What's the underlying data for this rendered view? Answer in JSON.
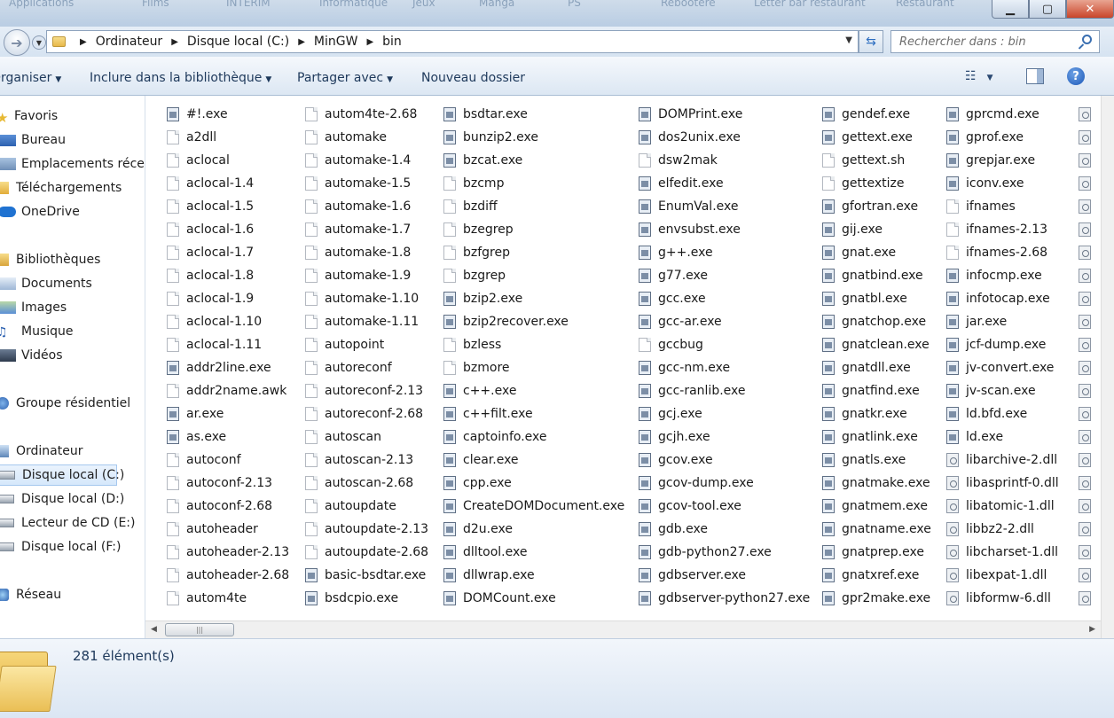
{
  "background_apps": [
    "Applications",
    "Films",
    "INTERIM",
    "Informatique",
    "Jeux",
    "Manga",
    "PS",
    "Rebootere",
    "Letter bar restaurant",
    "Restaurant"
  ],
  "window_controls": {
    "minimize": "▁",
    "maximize": "▢",
    "close": "✕"
  },
  "address": {
    "breadcrumbs": [
      "Ordinateur",
      "Disque local (C:)",
      "MinGW",
      "bin"
    ],
    "search_placeholder": "Rechercher dans : bin"
  },
  "toolbar": {
    "organize": "Organiser",
    "include_library": "Inclure dans la bibliothèque",
    "share_with": "Partager avec",
    "new_folder": "Nouveau dossier"
  },
  "sidebar": {
    "favorites": {
      "label": "Favoris",
      "items": [
        "Bureau",
        "Emplacements récents",
        "Téléchargements",
        "OneDrive"
      ]
    },
    "libraries": {
      "label": "Bibliothèques",
      "items": [
        "Documents",
        "Images",
        "Musique",
        "Vidéos"
      ]
    },
    "homegroup": "Groupe résidentiel",
    "computer": {
      "label": "Ordinateur",
      "items": [
        "Disque local (C:)",
        "Disque local (D:)",
        "Lecteur de CD (E:)",
        "Disque local (F:)"
      ],
      "selected": "Disque local (C:)"
    },
    "network": "Réseau"
  },
  "files": [
    [
      {
        "n": "#!.exe",
        "t": "exe"
      },
      {
        "n": "a2dll",
        "t": "file"
      },
      {
        "n": "aclocal",
        "t": "file"
      },
      {
        "n": "aclocal-1.4",
        "t": "file"
      },
      {
        "n": "aclocal-1.5",
        "t": "file"
      },
      {
        "n": "aclocal-1.6",
        "t": "file"
      },
      {
        "n": "aclocal-1.7",
        "t": "file"
      },
      {
        "n": "aclocal-1.8",
        "t": "file"
      },
      {
        "n": "aclocal-1.9",
        "t": "file"
      },
      {
        "n": "aclocal-1.10",
        "t": "file"
      },
      {
        "n": "aclocal-1.11",
        "t": "file"
      },
      {
        "n": "addr2line.exe",
        "t": "exe"
      },
      {
        "n": "addr2name.awk",
        "t": "file"
      },
      {
        "n": "ar.exe",
        "t": "exe"
      },
      {
        "n": "as.exe",
        "t": "exe"
      },
      {
        "n": "autoconf",
        "t": "file"
      },
      {
        "n": "autoconf-2.13",
        "t": "file"
      },
      {
        "n": "autoconf-2.68",
        "t": "file"
      },
      {
        "n": "autoheader",
        "t": "file"
      },
      {
        "n": "autoheader-2.13",
        "t": "file"
      },
      {
        "n": "autoheader-2.68",
        "t": "file"
      },
      {
        "n": "autom4te",
        "t": "file"
      }
    ],
    [
      {
        "n": "autom4te-2.68",
        "t": "file"
      },
      {
        "n": "automake",
        "t": "file"
      },
      {
        "n": "automake-1.4",
        "t": "file"
      },
      {
        "n": "automake-1.5",
        "t": "file"
      },
      {
        "n": "automake-1.6",
        "t": "file"
      },
      {
        "n": "automake-1.7",
        "t": "file"
      },
      {
        "n": "automake-1.8",
        "t": "file"
      },
      {
        "n": "automake-1.9",
        "t": "file"
      },
      {
        "n": "automake-1.10",
        "t": "file"
      },
      {
        "n": "automake-1.11",
        "t": "file"
      },
      {
        "n": "autopoint",
        "t": "file"
      },
      {
        "n": "autoreconf",
        "t": "file"
      },
      {
        "n": "autoreconf-2.13",
        "t": "file"
      },
      {
        "n": "autoreconf-2.68",
        "t": "file"
      },
      {
        "n": "autoscan",
        "t": "file"
      },
      {
        "n": "autoscan-2.13",
        "t": "file"
      },
      {
        "n": "autoscan-2.68",
        "t": "file"
      },
      {
        "n": "autoupdate",
        "t": "file"
      },
      {
        "n": "autoupdate-2.13",
        "t": "file"
      },
      {
        "n": "autoupdate-2.68",
        "t": "file"
      },
      {
        "n": "basic-bsdtar.exe",
        "t": "exe"
      },
      {
        "n": "bsdcpio.exe",
        "t": "exe"
      }
    ],
    [
      {
        "n": "bsdtar.exe",
        "t": "exe"
      },
      {
        "n": "bunzip2.exe",
        "t": "exe"
      },
      {
        "n": "bzcat.exe",
        "t": "exe"
      },
      {
        "n": "bzcmp",
        "t": "file"
      },
      {
        "n": "bzdiff",
        "t": "file"
      },
      {
        "n": "bzegrep",
        "t": "file"
      },
      {
        "n": "bzfgrep",
        "t": "file"
      },
      {
        "n": "bzgrep",
        "t": "file"
      },
      {
        "n": "bzip2.exe",
        "t": "exe"
      },
      {
        "n": "bzip2recover.exe",
        "t": "exe"
      },
      {
        "n": "bzless",
        "t": "file"
      },
      {
        "n": "bzmore",
        "t": "file"
      },
      {
        "n": "c++.exe",
        "t": "exe"
      },
      {
        "n": "c++filt.exe",
        "t": "exe"
      },
      {
        "n": "captoinfo.exe",
        "t": "exe"
      },
      {
        "n": "clear.exe",
        "t": "exe"
      },
      {
        "n": "cpp.exe",
        "t": "exe"
      },
      {
        "n": "CreateDOMDocument.exe",
        "t": "exe"
      },
      {
        "n": "d2u.exe",
        "t": "exe"
      },
      {
        "n": "dlltool.exe",
        "t": "exe"
      },
      {
        "n": "dllwrap.exe",
        "t": "exe"
      },
      {
        "n": "DOMCount.exe",
        "t": "exe"
      }
    ],
    [
      {
        "n": "DOMPrint.exe",
        "t": "exe"
      },
      {
        "n": "dos2unix.exe",
        "t": "exe"
      },
      {
        "n": "dsw2mak",
        "t": "file"
      },
      {
        "n": "elfedit.exe",
        "t": "exe"
      },
      {
        "n": "EnumVal.exe",
        "t": "exe"
      },
      {
        "n": "envsubst.exe",
        "t": "exe"
      },
      {
        "n": "g++.exe",
        "t": "exe"
      },
      {
        "n": "g77.exe",
        "t": "exe"
      },
      {
        "n": "gcc.exe",
        "t": "exe"
      },
      {
        "n": "gcc-ar.exe",
        "t": "exe"
      },
      {
        "n": "gccbug",
        "t": "file"
      },
      {
        "n": "gcc-nm.exe",
        "t": "exe"
      },
      {
        "n": "gcc-ranlib.exe",
        "t": "exe"
      },
      {
        "n": "gcj.exe",
        "t": "exe"
      },
      {
        "n": "gcjh.exe",
        "t": "exe"
      },
      {
        "n": "gcov.exe",
        "t": "exe"
      },
      {
        "n": "gcov-dump.exe",
        "t": "exe"
      },
      {
        "n": "gcov-tool.exe",
        "t": "exe"
      },
      {
        "n": "gdb.exe",
        "t": "exe"
      },
      {
        "n": "gdb-python27.exe",
        "t": "exe"
      },
      {
        "n": "gdbserver.exe",
        "t": "exe"
      },
      {
        "n": "gdbserver-python27.exe",
        "t": "exe"
      }
    ],
    [
      {
        "n": "gendef.exe",
        "t": "exe"
      },
      {
        "n": "gettext.exe",
        "t": "exe"
      },
      {
        "n": "gettext.sh",
        "t": "file"
      },
      {
        "n": "gettextize",
        "t": "file"
      },
      {
        "n": "gfortran.exe",
        "t": "exe"
      },
      {
        "n": "gij.exe",
        "t": "exe"
      },
      {
        "n": "gnat.exe",
        "t": "exe"
      },
      {
        "n": "gnatbind.exe",
        "t": "exe"
      },
      {
        "n": "gnatbl.exe",
        "t": "exe"
      },
      {
        "n": "gnatchop.exe",
        "t": "exe"
      },
      {
        "n": "gnatclean.exe",
        "t": "exe"
      },
      {
        "n": "gnatdll.exe",
        "t": "exe"
      },
      {
        "n": "gnatfind.exe",
        "t": "exe"
      },
      {
        "n": "gnatkr.exe",
        "t": "exe"
      },
      {
        "n": "gnatlink.exe",
        "t": "exe"
      },
      {
        "n": "gnatls.exe",
        "t": "exe"
      },
      {
        "n": "gnatmake.exe",
        "t": "exe"
      },
      {
        "n": "gnatmem.exe",
        "t": "exe"
      },
      {
        "n": "gnatname.exe",
        "t": "exe"
      },
      {
        "n": "gnatprep.exe",
        "t": "exe"
      },
      {
        "n": "gnatxref.exe",
        "t": "exe"
      },
      {
        "n": "gpr2make.exe",
        "t": "exe"
      }
    ],
    [
      {
        "n": "gprcmd.exe",
        "t": "exe"
      },
      {
        "n": "gprof.exe",
        "t": "exe"
      },
      {
        "n": "grepjar.exe",
        "t": "exe"
      },
      {
        "n": "iconv.exe",
        "t": "exe"
      },
      {
        "n": "ifnames",
        "t": "file"
      },
      {
        "n": "ifnames-2.13",
        "t": "file"
      },
      {
        "n": "ifnames-2.68",
        "t": "file"
      },
      {
        "n": "infocmp.exe",
        "t": "exe"
      },
      {
        "n": "infotocap.exe",
        "t": "exe"
      },
      {
        "n": "jar.exe",
        "t": "exe"
      },
      {
        "n": "jcf-dump.exe",
        "t": "exe"
      },
      {
        "n": "jv-convert.exe",
        "t": "exe"
      },
      {
        "n": "jv-scan.exe",
        "t": "exe"
      },
      {
        "n": "ld.bfd.exe",
        "t": "exe"
      },
      {
        "n": "ld.exe",
        "t": "exe"
      },
      {
        "n": "libarchive-2.dll",
        "t": "dll"
      },
      {
        "n": "libasprintf-0.dll",
        "t": "dll"
      },
      {
        "n": "libatomic-1.dll",
        "t": "dll"
      },
      {
        "n": "libbz2-2.dll",
        "t": "dll"
      },
      {
        "n": "libcharset-1.dll",
        "t": "dll"
      },
      {
        "n": "libexpat-1.dll",
        "t": "dll"
      },
      {
        "n": "libformw-6.dll",
        "t": "dll"
      }
    ]
  ],
  "status": {
    "count": "281 élément(s)"
  }
}
